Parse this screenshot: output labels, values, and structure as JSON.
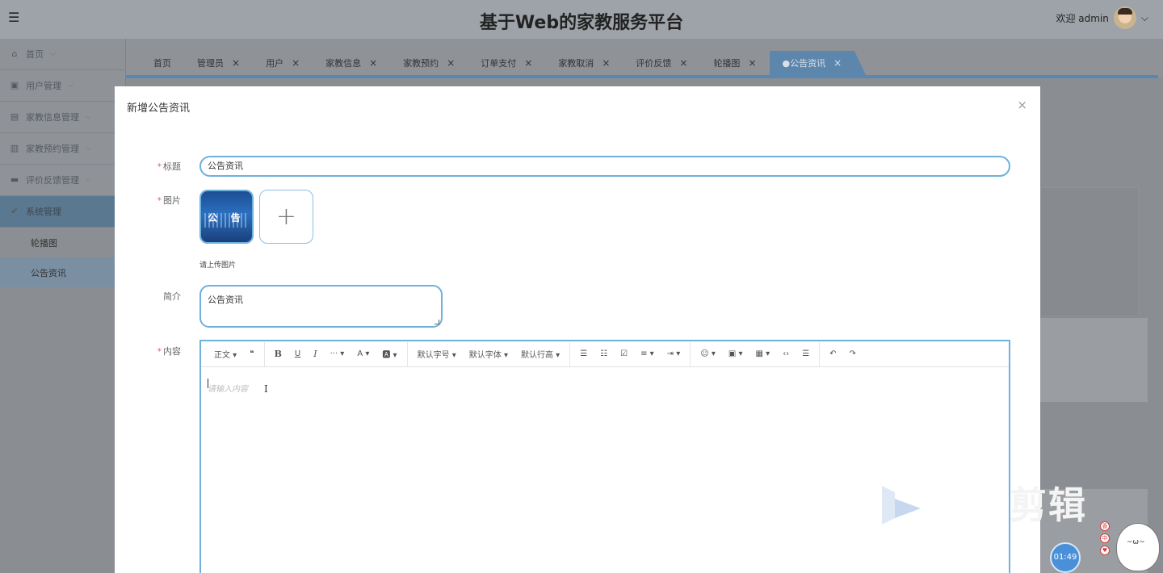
{
  "header": {
    "title": "基于Web的家教服务平台",
    "welcome": "欢迎 admin",
    "menu_icon": "hamburger-icon",
    "caret": "⌵"
  },
  "sidebar": {
    "items": [
      {
        "label": "首页",
        "icon": "home-icon"
      },
      {
        "label": "用户管理",
        "icon": "users-icon"
      },
      {
        "label": "家教信息管理",
        "icon": "info-icon"
      },
      {
        "label": "家教预约管理",
        "icon": "calendar-icon"
      },
      {
        "label": "评价反馈管理",
        "icon": "feedback-icon"
      },
      {
        "label": "系统管理",
        "icon": "settings-icon"
      }
    ],
    "subitems": [
      {
        "label": "轮播图"
      },
      {
        "label": "公告资讯"
      }
    ]
  },
  "tabs": [
    {
      "label": "首页",
      "closable": false
    },
    {
      "label": "管理员",
      "closable": true
    },
    {
      "label": "用户",
      "closable": true
    },
    {
      "label": "家教信息",
      "closable": true
    },
    {
      "label": "家教预约",
      "closable": true
    },
    {
      "label": "订单支付",
      "closable": true
    },
    {
      "label": "家教取消",
      "closable": true
    },
    {
      "label": "评价反馈",
      "closable": true
    },
    {
      "label": "轮播图",
      "closable": true
    },
    {
      "label": "●公告资讯",
      "closable": true
    }
  ],
  "modal": {
    "title": "新增公告资讯",
    "close": "×",
    "fields": {
      "title_label": "标题",
      "title_value": "公告资讯",
      "image_label": "图片",
      "image_thumb_text": "公 告",
      "upload_plus": "+",
      "upload_tip": "请上传图片",
      "intro_label": "简介",
      "intro_value": "公告资讯",
      "content_label": "内容",
      "content_placeholder": "请输入内容",
      "required_mark": "*"
    },
    "toolbar": {
      "paragraph": "正文 ▾",
      "quote": "❝",
      "bold": "B",
      "underline": "U",
      "italic": "I",
      "more": "··· ▾",
      "font_color": "A ▾",
      "bg_color": "🅰 ▾",
      "font_size": "默认字号 ▾",
      "font_family": "默认字体 ▾",
      "line_height": "默认行高 ▾",
      "bullet_list": "☰",
      "number_list": "☷",
      "todo": "☑",
      "align": "≡ ▾",
      "indent": "⇥ ▾",
      "emoji": "☺ ▾",
      "image": "▣ ▾",
      "table": "▦ ▾",
      "code": "‹›",
      "divider": "☰",
      "undo": "↶",
      "redo": "↷"
    }
  },
  "overlay": {
    "watermark": "剪辑",
    "timer": "01:49",
    "mascot_face": "~ω~",
    "mini_buttons": [
      "香",
      "中",
      "♥"
    ]
  }
}
